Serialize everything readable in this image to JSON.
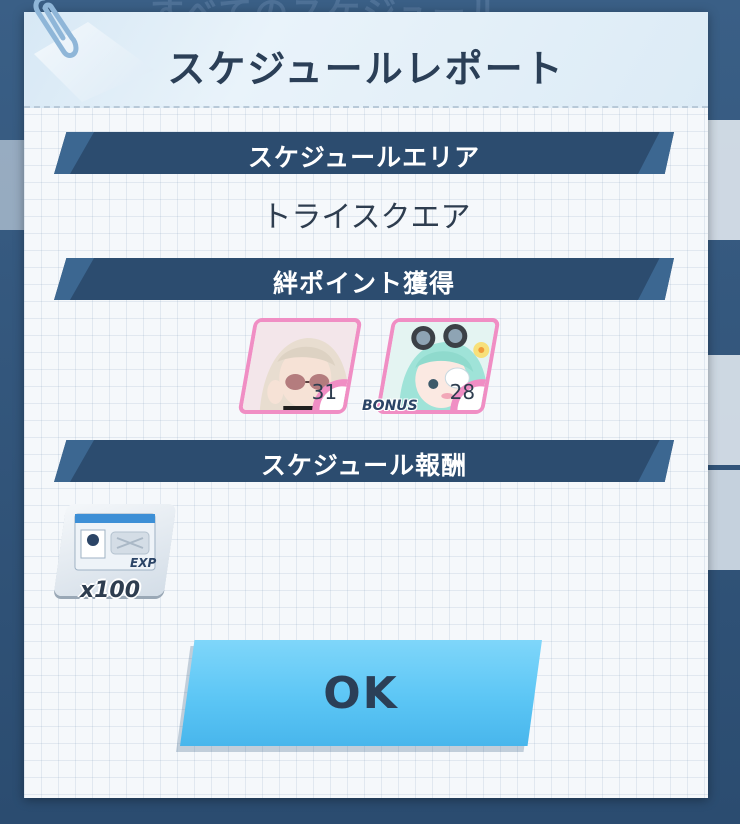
{
  "background": {
    "title": "すべてのスケジュール"
  },
  "dialog": {
    "title": "スケジュールレポート",
    "sections": {
      "area_label": "スケジュールエリア",
      "area_value": "トライスクエア",
      "bond_label": "絆ポイント獲得",
      "reward_label": "スケジュール報酬"
    },
    "bond_characters": [
      {
        "points": "31",
        "icon": "student-portrait-sunglasses-icon"
      },
      {
        "points": "28",
        "icon": "student-portrait-goggles-icon"
      }
    ],
    "bonus_label": "BONUS",
    "reward": {
      "icon": "exp-report-icon",
      "tag": "EXP",
      "quantity": "x100"
    },
    "ok_label": "OK"
  },
  "colors": {
    "bar": "#2c4c6f",
    "heart": "#f08ec4",
    "ok_button": "#5cc6f5",
    "text_dark": "#2b3f57"
  }
}
